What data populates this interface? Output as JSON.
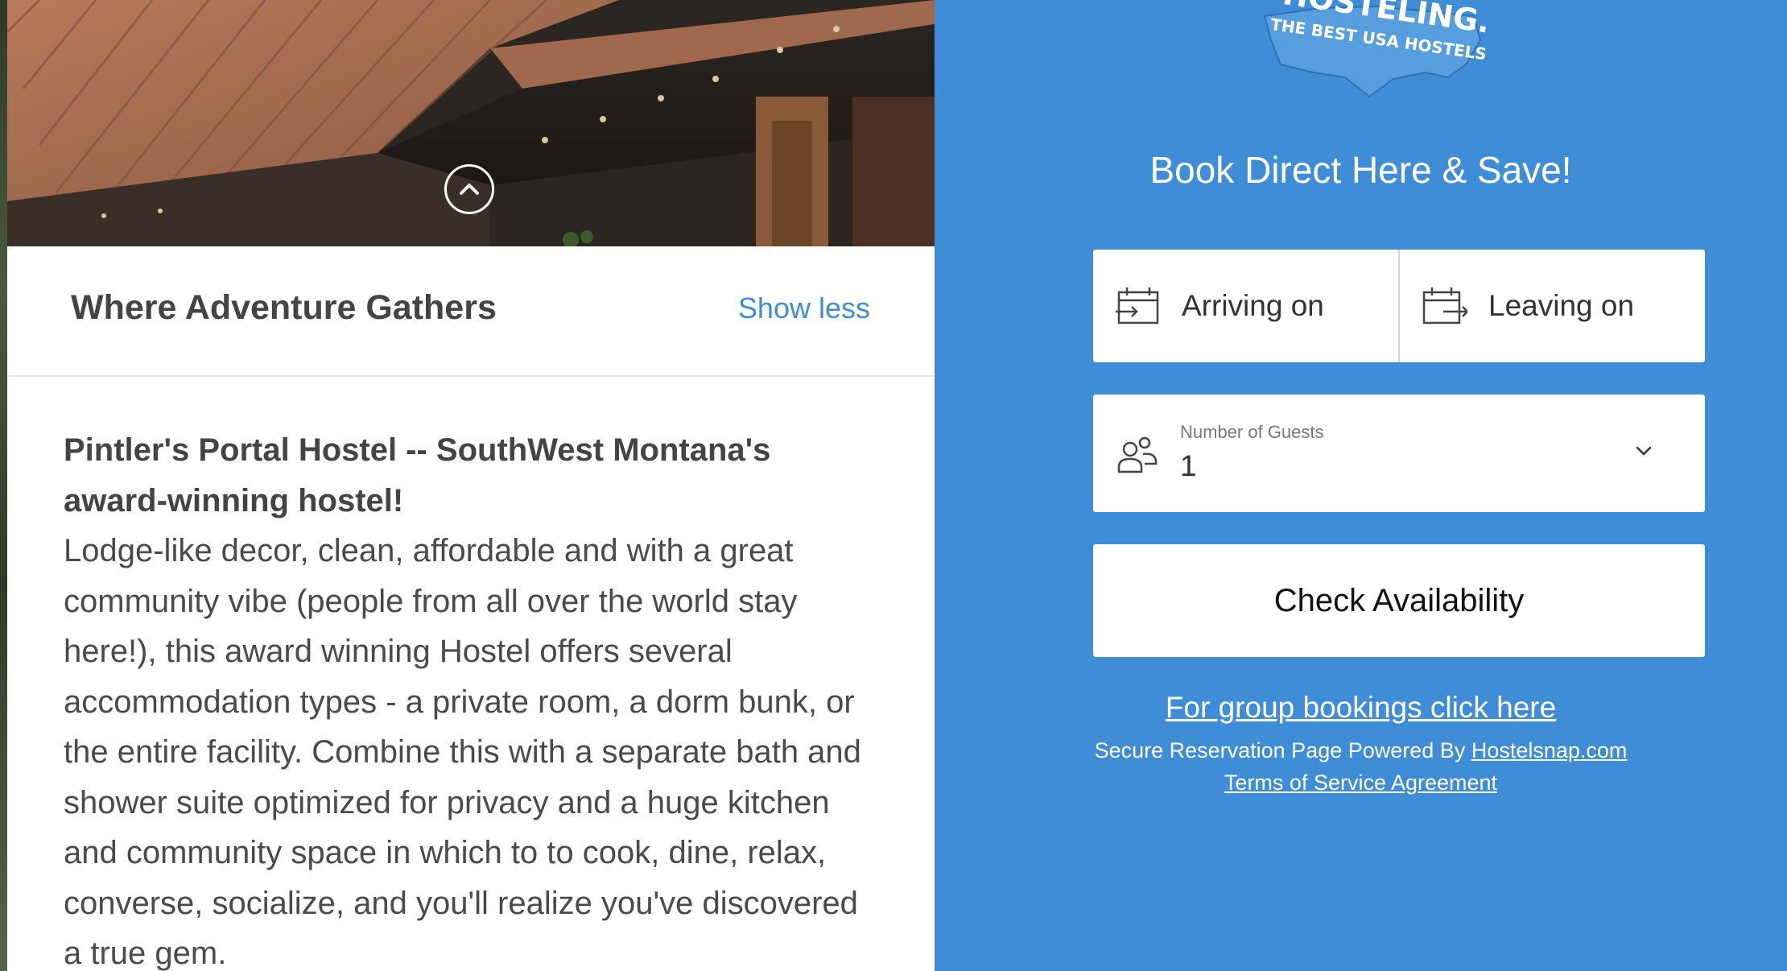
{
  "hero": {
    "collapse_icon": "chevron-up-circle-icon"
  },
  "info": {
    "title": "Where Adventure Gathers",
    "toggle_label": "Show less",
    "lead": "Pintler's Portal Hostel -- SouthWest Montana's award-winning hostel!",
    "body": "Lodge-like decor, clean, affordable and with a great community vibe (people from all over the world stay here!), this award winning Hostel offers several accommodation types -  a private room, a dorm bunk, or the entire facility. Combine this with a separate bath and shower suite optimized for privacy and a huge kitchen and community space in which to to cook, dine, relax, converse, socialize, and you'll realize you've discovered a true gem."
  },
  "booking": {
    "logo_line1": "HOSTELING.US",
    "logo_line2": "THE BEST USA HOSTELS",
    "title": "Book Direct Here & Save!",
    "arriving_label": "Arriving on",
    "leaving_label": "Leaving on",
    "guests_label": "Number of Guests",
    "guests_value": "1",
    "check_button": "Check Availability",
    "group_link": "For group bookings click here",
    "secure_text": "Secure Reservation Page Powered By ",
    "secure_link": "Hostelsnap.com",
    "tos_link": "Terms of Service Agreement"
  },
  "colors": {
    "brand_blue": "#3f8dd6",
    "link_blue": "#3f8dd6",
    "text_dark": "#444444"
  }
}
